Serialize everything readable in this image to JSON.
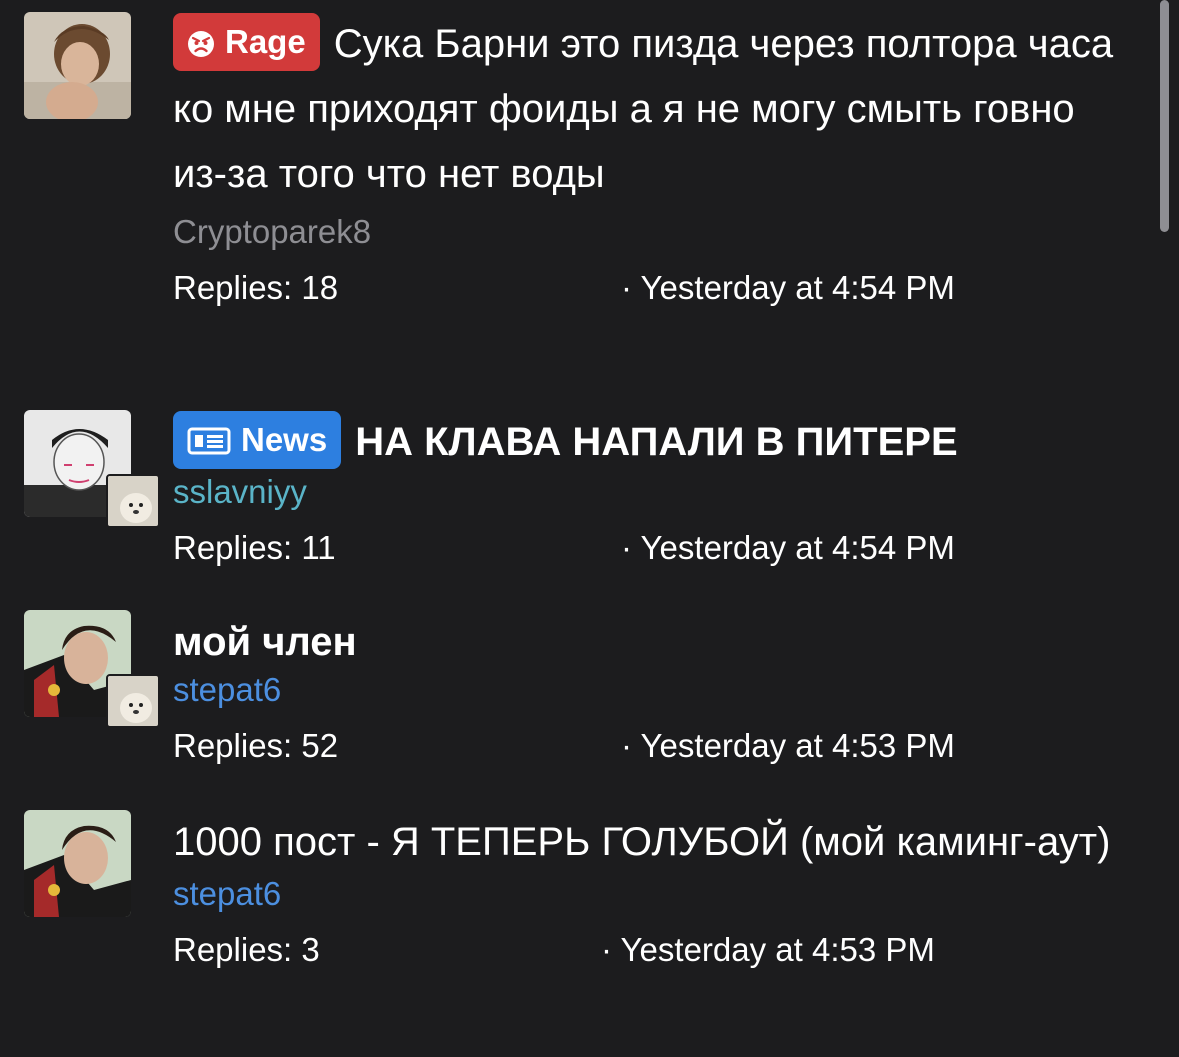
{
  "colors": {
    "background": "#1c1c1e",
    "rage_prefix": "#d23a3a",
    "news_prefix": "#2d7fe0",
    "author_grey": "#8e8e93",
    "author_teal": "#5ab4c8",
    "author_blue": "#4c8fe0"
  },
  "threads": [
    {
      "prefix": {
        "label": "Rage",
        "icon": "angry-face-icon"
      },
      "title": "Сука Барни это пизда через полтора часа ко мне приходят фоиды а я не могу смыть говно из-за того что нет воды",
      "author": "Cryptoparek8",
      "replies": "Replies: 18",
      "date": "· Yesterday at 4:54 PM"
    },
    {
      "prefix": {
        "label": "News",
        "icon": "newspaper-icon"
      },
      "title": "НА КЛАВА НАПАЛИ В ПИТЕРЕ",
      "author": "sslavniyy",
      "replies": "Replies: 11",
      "date": "· Yesterday at 4:54 PM"
    },
    {
      "title": "мой член",
      "author": "stepat6",
      "replies": "Replies: 52",
      "date": "· Yesterday at 4:53 PM"
    },
    {
      "title": "1000 пост - Я ТЕПЕРЬ ГОЛУБОЙ (мой каминг-аут)",
      "author": "stepat6",
      "replies": "Replies: 3",
      "date": "· Yesterday at 4:53 PM"
    }
  ]
}
